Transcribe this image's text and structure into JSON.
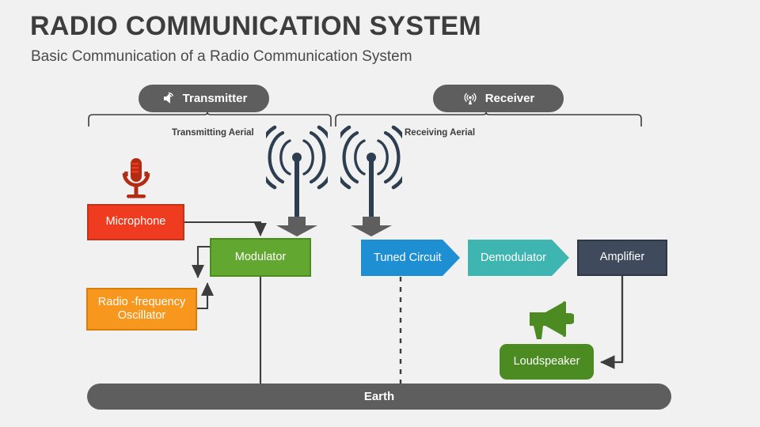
{
  "header": {
    "title": "RADIO COMMUNICATION SYSTEM",
    "subtitle": "Basic Communication of a Radio Communication System"
  },
  "sections": [
    {
      "id": "transmitter",
      "label": "Transmitter",
      "icon": "speaker-waves-icon",
      "aerial_label": "Transmitting Aerial"
    },
    {
      "id": "receiver",
      "label": "Receiver",
      "icon": "broadcast-tower-icon",
      "aerial_label": "Receiving Aerial"
    }
  ],
  "blocks": {
    "microphone": {
      "label": "Microphone",
      "color": "#ef3b1f",
      "icon": "microphone-icon",
      "icon_color": "#b32b12"
    },
    "modulator": {
      "label": "Modulator",
      "color": "#62a730"
    },
    "oscillator": {
      "label": "Radio -frequency Oscillator",
      "line1": "Radio -frequency",
      "line2": "Oscillator",
      "color": "#f8971d"
    },
    "tuned_circuit": {
      "label": "Tuned Circuit",
      "color": "#1f8fd4"
    },
    "demodulator": {
      "label": "Demodulator",
      "color": "#3eb5b0"
    },
    "amplifier": {
      "label": "Amplifier",
      "color": "#3f4a5c"
    },
    "loudspeaker": {
      "label": "Loudspeaker",
      "color": "#4c8a22",
      "icon": "megaphone-icon",
      "icon_color": "#4c8a22"
    },
    "earth": {
      "label": "Earth",
      "color": "#5e5e5e"
    }
  },
  "antennas": [
    {
      "id": "transmitting-antenna",
      "icon": "antenna-waves-icon",
      "color": "#2d3e50"
    },
    {
      "id": "receiving-antenna",
      "icon": "antenna-waves-icon",
      "color": "#2d3e50"
    }
  ],
  "colors": {
    "background": "#f1f1f1",
    "text_dark": "#3d3d3d",
    "wire": "#3d3d3d",
    "gray_arrow": "#5e5e5e",
    "antenna": "#2d3e50"
  }
}
